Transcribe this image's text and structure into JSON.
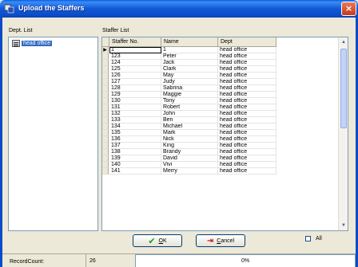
{
  "window": {
    "title": "Upload the Staffers",
    "close_glyph": "×"
  },
  "dept_list": {
    "label": "Dept. List",
    "items": [
      "head office"
    ]
  },
  "staffer_list": {
    "label": "Staffer List",
    "columns": [
      "Staffer No.",
      "Name",
      "Dept"
    ],
    "rows": [
      [
        "1",
        "1",
        "head office"
      ],
      [
        "123",
        "Peter",
        "head office"
      ],
      [
        "124",
        "Jack",
        "head office"
      ],
      [
        "125",
        "Clark",
        "head office"
      ],
      [
        "126",
        "May",
        "head office"
      ],
      [
        "127",
        "Judy",
        "head office"
      ],
      [
        "128",
        "Sabrina",
        "head office"
      ],
      [
        "129",
        "Maggie",
        "head office"
      ],
      [
        "130",
        "Tony",
        "head office"
      ],
      [
        "131",
        "Robert",
        "head office"
      ],
      [
        "132",
        "John",
        "head office"
      ],
      [
        "133",
        "Ben",
        "head office"
      ],
      [
        "134",
        "Michael",
        "head office"
      ],
      [
        "135",
        "Mark",
        "head office"
      ],
      [
        "136",
        "Nick",
        "head office"
      ],
      [
        "137",
        "King",
        "head office"
      ],
      [
        "138",
        "Brandy",
        "head office"
      ],
      [
        "139",
        "David",
        "head office"
      ],
      [
        "140",
        "Vivi",
        "head office"
      ],
      [
        "141",
        "Merry",
        "head office"
      ]
    ]
  },
  "buttons": {
    "ok_mnemonic": "O",
    "ok_rest": "K",
    "cancel_mnemonic": "C",
    "cancel_rest": "ancel"
  },
  "all_checkbox": {
    "label": "All",
    "checked": false
  },
  "status": {
    "label": "RecordCount:",
    "count": "26",
    "progress": "0%"
  },
  "icons": [
    "app-icon",
    "close-icon",
    "dept-icon",
    "row-pointer-icon",
    "scroll-up-icon",
    "scroll-down-icon",
    "check-icon",
    "cancel-icon"
  ],
  "colors": {
    "title_bar": "#0a4cc8",
    "selection": "#316ac5",
    "window_bg": "#ece9d8"
  }
}
